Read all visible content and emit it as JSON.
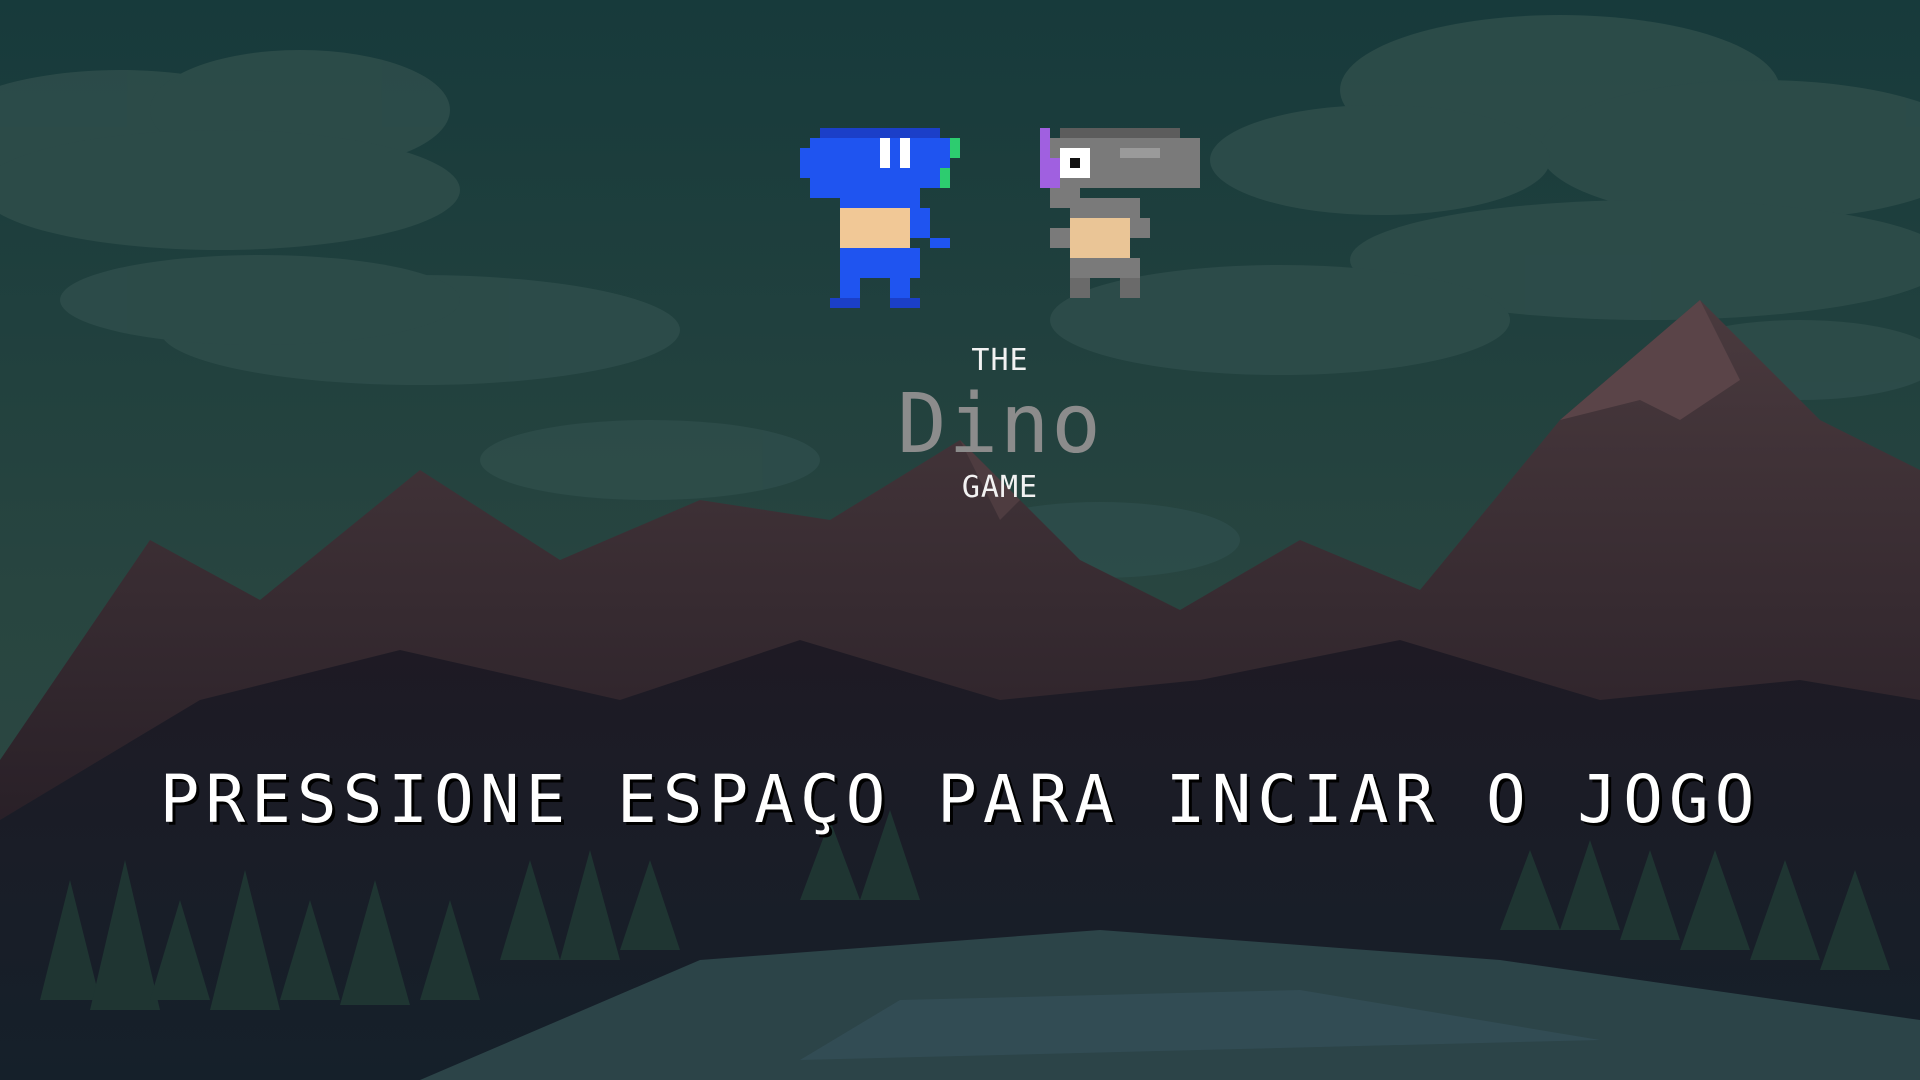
{
  "game": {
    "title_top": "THE",
    "title_main": "Dino",
    "title_bottom": "GAME",
    "start_prompt": "PRESSIONE ESPAÇO PARA INCIAR O JOGO"
  },
  "characters": [
    {
      "name": "blue-dino",
      "color": "#1f4fe0"
    },
    {
      "name": "gray-dino",
      "color": "#7a7a7a"
    }
  ],
  "colors": {
    "sky": "#1b3d3f",
    "cloud": "#2b4a48",
    "mountain": "#3a2a30",
    "ground": "#1a1822",
    "lake": "#2b4448",
    "text": "#ffffff",
    "dino_logo": "#8c8c8c"
  }
}
